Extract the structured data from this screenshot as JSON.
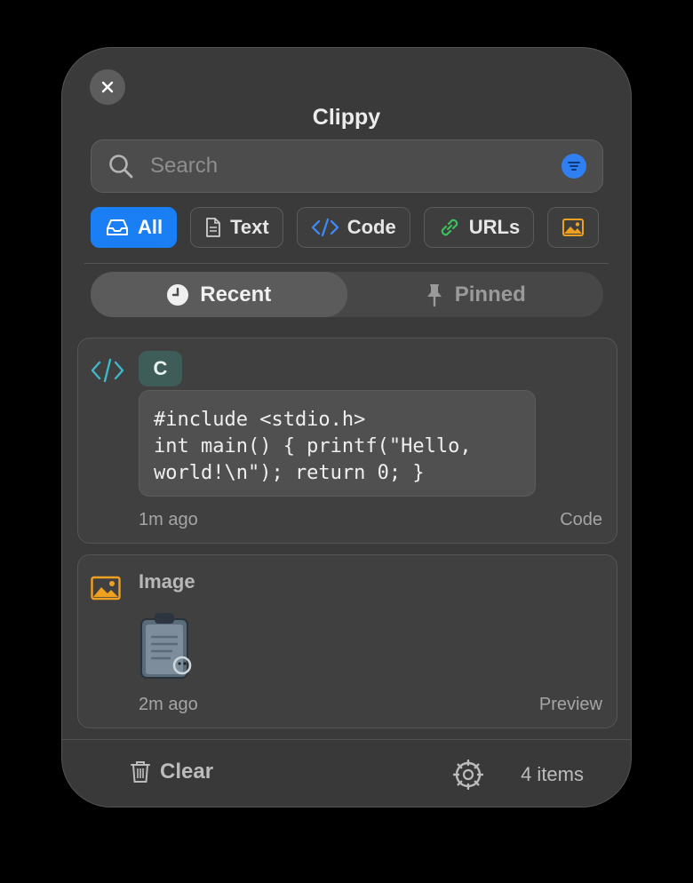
{
  "window": {
    "title": "Clippy"
  },
  "search": {
    "placeholder": "Search"
  },
  "filters": [
    {
      "label": "All",
      "icon": "tray-icon",
      "active": true
    },
    {
      "label": "Text",
      "icon": "document-icon",
      "active": false
    },
    {
      "label": "Code",
      "icon": "code-icon",
      "active": false
    },
    {
      "label": "URLs",
      "icon": "link-icon",
      "active": false
    },
    {
      "label": "",
      "icon": "image-icon",
      "active": false
    }
  ],
  "segments": [
    {
      "label": "Recent",
      "icon": "clock-icon",
      "active": true
    },
    {
      "label": "Pinned",
      "icon": "pin-icon",
      "active": false
    }
  ],
  "items": [
    {
      "type": "code",
      "badge": "C",
      "content": "#include <stdio.h>\nint main() { printf(\"Hello,\nworld!\\n\"); return 0; }",
      "time": "1m ago",
      "kind": "Code"
    },
    {
      "type": "image",
      "label": "Image",
      "time": "2m ago",
      "kind": "Preview"
    }
  ],
  "footer": {
    "clear_label": "Clear",
    "count": "4 items"
  },
  "colors": {
    "accent": "#1a7ff5",
    "code_icon": "#3fb8c9",
    "image_icon": "#f0a020",
    "link_icon": "#3cc05a",
    "code_badge": "#3f5d58"
  }
}
